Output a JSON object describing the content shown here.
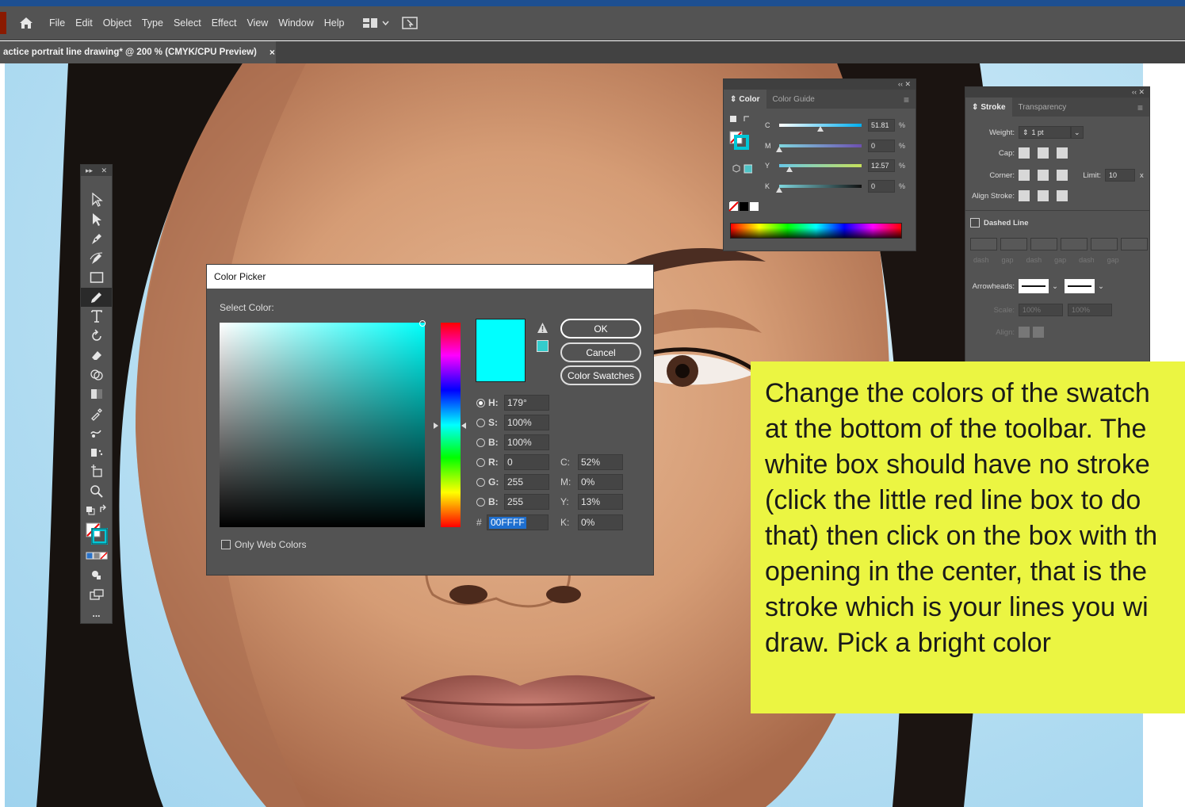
{
  "menubar": {
    "items": [
      "File",
      "Edit",
      "Object",
      "Type",
      "Select",
      "Effect",
      "View",
      "Window",
      "Help"
    ]
  },
  "document_tab": {
    "title": "actice portrait line drawing* @ 200 % (CMYK/CPU Preview)",
    "close": "×"
  },
  "toolbar": {
    "tools": [
      "selection-tool",
      "direct-selection-tool",
      "pen-tool",
      "curvature-tool",
      "rectangle-tool",
      "pencil-tool",
      "type-tool",
      "rotate-tool",
      "eraser-tool",
      "shape-builder-tool",
      "gradient-tool",
      "eyedropper-tool",
      "blend-tool",
      "symbol-sprayer-tool",
      "artboard-tool",
      "zoom-tool"
    ],
    "more": "..."
  },
  "color_picker": {
    "title": "Color Picker",
    "select_label": "Select Color:",
    "ok": "OK",
    "cancel": "Cancel",
    "swatches": "Color Swatches",
    "preview_color": "#00ffff",
    "hsb": [
      {
        "label": "H:",
        "value": "179°",
        "selected": true
      },
      {
        "label": "S:",
        "value": "100%",
        "selected": false
      },
      {
        "label": "B:",
        "value": "100%",
        "selected": false
      }
    ],
    "rgb": [
      {
        "label": "R:",
        "value": "0"
      },
      {
        "label": "G:",
        "value": "255"
      },
      {
        "label": "B:",
        "value": "255"
      }
    ],
    "cmyk": [
      {
        "label": "C:",
        "value": "52%"
      },
      {
        "label": "M:",
        "value": "0%"
      },
      {
        "label": "Y:",
        "value": "13%"
      },
      {
        "label": "K:",
        "value": "0%"
      }
    ],
    "hex_label": "#",
    "hex_value": "00FFFF",
    "only_web_colors": "Only Web Colors"
  },
  "color_panel": {
    "tab_color": "Color",
    "tab_guide": "Color Guide",
    "sliders": [
      {
        "label": "C",
        "value": "51.81",
        "unit": "%",
        "level": 0.52
      },
      {
        "label": "M",
        "value": "0",
        "unit": "%",
        "level": 0.0
      },
      {
        "label": "Y",
        "value": "12.57",
        "unit": "%",
        "level": 0.13
      },
      {
        "label": "K",
        "value": "0",
        "unit": "%",
        "level": 0.0
      }
    ]
  },
  "stroke_panel": {
    "tab_stroke": "Stroke",
    "tab_transparency": "Transparency",
    "weight_label": "Weight:",
    "weight_value": "1 pt",
    "cap_label": "Cap:",
    "corner_label": "Corner:",
    "limit_label": "Limit:",
    "limit_value": "10",
    "limit_unit": "x",
    "align_label": "Align Stroke:",
    "dashed_label": "Dashed Line",
    "dash_labels": [
      "dash",
      "gap",
      "dash",
      "gap",
      "dash",
      "gap"
    ],
    "arrowheads_label": "Arrowheads:",
    "scale_label": "Scale:",
    "scale_value_1": "100%",
    "scale_value_2": "100%",
    "align_arrow_label": "Align:"
  },
  "note": {
    "text": "Change the colors of the swatch\nat the bottom of the toolbar. The\nwhite box should have no stroke\n(click the little red line box to do\nthat) then click on the box with th\nopening in the center, that is the\nstroke which is your lines you wi\ndraw. Pick a bright color"
  },
  "colors": {
    "ui_bg": "#535353",
    "accent": "#1e6fd0",
    "note_bg": "#ebf542"
  }
}
